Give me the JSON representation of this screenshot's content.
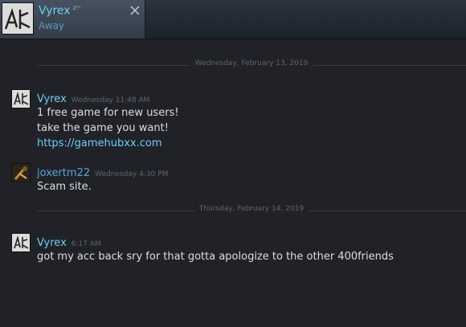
{
  "tab": {
    "name": "Vyrex",
    "away_marker": "zᶻᶻ",
    "status": "Away"
  },
  "dividers": [
    {
      "label": "Wednesday, February 13, 2019"
    },
    {
      "label": "Thursday, February 14, 2019"
    }
  ],
  "messages": [
    {
      "user": "Vyrex",
      "time": "Wednesday 11:48 AM",
      "lines": [
        "1 free game for new users!",
        "take the game you want!"
      ],
      "link": "https://gamehubxx.com"
    },
    {
      "user": "joxertm22",
      "time": "Wednesday 4:30 PM",
      "lines": [
        "Scam site."
      ]
    },
    {
      "user": "Vyrex",
      "time": "6:17 AM",
      "lines": [
        "got my acc back sry for that gotta apologize to the other 400friends"
      ]
    }
  ]
}
